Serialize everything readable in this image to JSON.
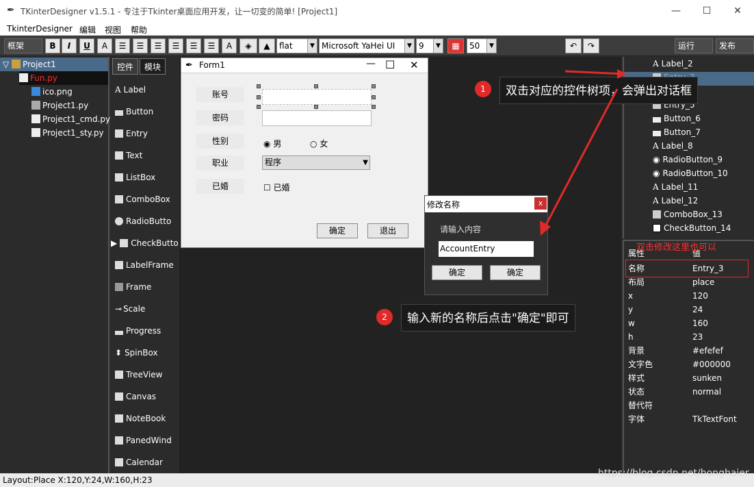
{
  "window": {
    "title": "TKinterDesigner v1.5.1 - 专注于Tkinter桌面应用开发，让一切变的简单!    [Project1]",
    "minimize": "—",
    "maximize": "☐",
    "close": "✕"
  },
  "menu": [
    "TkinterDesigner",
    "编辑",
    "视图",
    "帮助"
  ],
  "toolbar": {
    "frame_select": "框架",
    "bold": "B",
    "italic": "I",
    "underline": "U",
    "font_color": "A",
    "relief": "flat",
    "font_family": "Microsoft YaHei UI",
    "font_size": "9",
    "grid_size": "50",
    "run": "运行",
    "publish": "发布"
  },
  "project_tree": {
    "root": "Project1",
    "files": [
      {
        "name": "Fun.py",
        "color": "#ff2a2a"
      },
      {
        "name": "ico.png",
        "color": "#ffffff"
      },
      {
        "name": "Project1.py",
        "color": "#ffffff"
      },
      {
        "name": "Project1_cmd.py",
        "color": "#ffffff"
      },
      {
        "name": "Project1_sty.py",
        "color": "#ffffff"
      }
    ]
  },
  "controls": {
    "tabs": [
      "控件",
      "模块"
    ],
    "items": [
      "Label",
      "Button",
      "Entry",
      "Text",
      "ListBox",
      "ComboBox",
      "RadioButto",
      "CheckButto",
      "LabelFrame",
      "Frame",
      "Scale",
      "Progress",
      "SpinBox",
      "TreeView",
      "Canvas",
      "NoteBook",
      "PanedWind",
      "Calendar"
    ]
  },
  "form": {
    "title": "Form1",
    "labels": [
      "账号",
      "密码",
      "性别",
      "职业",
      "已婚"
    ],
    "radio_male": "男",
    "radio_female": "女",
    "job_value": "程序",
    "check_label": "已婚",
    "ok_button": "确定",
    "exit_button": "退出"
  },
  "dialog": {
    "title": "修改名称",
    "close": "x",
    "prompt": "请输入内容",
    "input_value": "AccountEntry",
    "button1": "确定",
    "button2": "确定"
  },
  "widget_tree": {
    "items": [
      {
        "name": "Label_2",
        "icon": "A"
      },
      {
        "name": "Entry_3",
        "icon": "entry"
      },
      {
        "name": "Entry_5",
        "icon": "entry"
      },
      {
        "name": "Button_6",
        "icon": "button"
      },
      {
        "name": "Button_7",
        "icon": "button"
      },
      {
        "name": "Label_8",
        "icon": "A"
      },
      {
        "name": "RadioButton_9",
        "icon": "radio"
      },
      {
        "name": "RadioButton_10",
        "icon": "radio"
      },
      {
        "name": "Label_11",
        "icon": "A"
      },
      {
        "name": "Label_12",
        "icon": "A"
      },
      {
        "name": "ComboBox_13",
        "icon": "combo"
      },
      {
        "name": "CheckButton_14",
        "icon": "check"
      }
    ],
    "selected": "Entry_3"
  },
  "properties": {
    "header_key": "属性",
    "header_value": "值",
    "hint": "双击修改这里也可以",
    "rows": [
      {
        "k": "名称",
        "v": "Entry_3"
      },
      {
        "k": "布局",
        "v": "place"
      },
      {
        "k": "x",
        "v": "120"
      },
      {
        "k": "y",
        "v": "24"
      },
      {
        "k": "w",
        "v": "160"
      },
      {
        "k": "h",
        "v": "23"
      },
      {
        "k": "背景",
        "v": "#efefef"
      },
      {
        "k": "文字色",
        "v": "#000000"
      },
      {
        "k": "样式",
        "v": "sunken"
      },
      {
        "k": "状态",
        "v": "normal"
      },
      {
        "k": "替代符",
        "v": ""
      },
      {
        "k": "字体",
        "v": "TkTextFont"
      }
    ]
  },
  "status": "Layout:Place   X:120,Y:24,W:160,H:23",
  "annotations": {
    "callout1_num": "1",
    "callout1": "双击对应的控件树项，会弹出对话框",
    "callout2_num": "2",
    "callout2": "输入新的名称后点击\"确定\"即可",
    "watermark": "https://blog.csdn.net/honghaier"
  },
  "colors": {
    "accent_red": "#e02a2a",
    "dark_bg": "#2b2b2b",
    "selection": "#4a6a8a"
  }
}
